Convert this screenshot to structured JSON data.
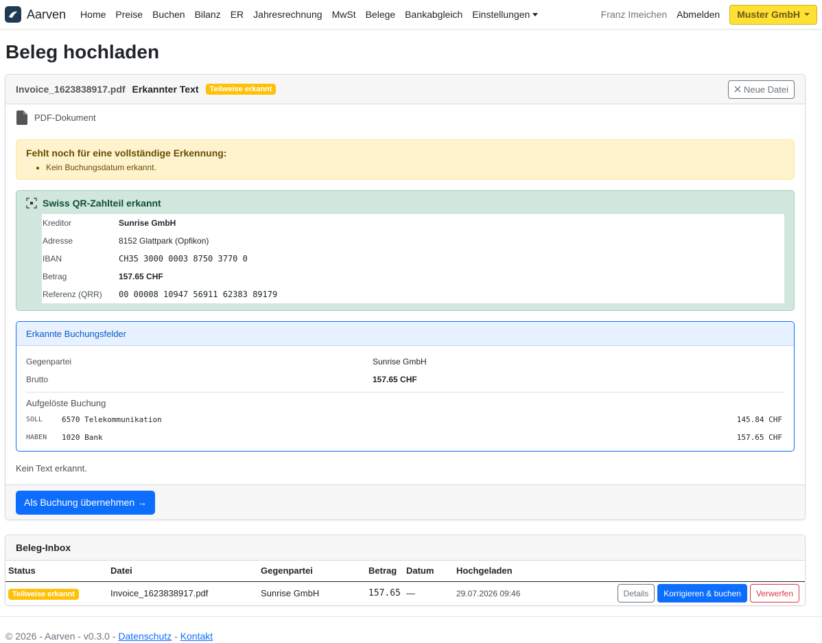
{
  "nav": {
    "brand": "Aarven",
    "items": [
      "Home",
      "Preise",
      "Buchen",
      "Bilanz",
      "ER",
      "Jahresrechnung",
      "MwSt",
      "Belege",
      "Bankabgleich"
    ],
    "settings": "Einstellungen",
    "user": "Franz Imeichen",
    "logout": "Abmelden",
    "org": "Muster GmbH"
  },
  "page_title": "Beleg hochladen",
  "upload": {
    "file_name": "Invoice_1623838917.pdf",
    "recognized_label": "Erkannter Text",
    "status_badge": "Teilweise erkannt",
    "new_file_button": "Neue Datei",
    "doc_type": "PDF-Dokument",
    "missing_title": "Fehlt noch für eine vollständige Erkennung:",
    "missing_items": [
      "Kein Buchungsdatum erkannt."
    ],
    "qr": {
      "title": "Swiss QR-Zahlteil erkannt",
      "rows": [
        {
          "label": "Kreditor",
          "value": "Sunrise GmbH"
        },
        {
          "label": "Adresse",
          "value": "8152 Glattpark (Opfikon)"
        },
        {
          "label": "IBAN",
          "value": "CH35 3000 0003 8750 3770 0"
        },
        {
          "label": "Betrag",
          "value": "157.65 CHF"
        },
        {
          "label": "Referenz (QRR)",
          "value": "00 00008 10947 56911 62383 89179"
        }
      ]
    },
    "fields": {
      "title": "Erkannte Buchungsfelder",
      "counterparty_label": "Gegenpartei",
      "counterparty_value": "Sunrise GmbH",
      "gross_label": "Brutto",
      "gross_value": "157.65 CHF",
      "resolved_title": "Aufgelöste Buchung",
      "entries": [
        {
          "side": "SOLL",
          "account": "6570 Telekommunikation",
          "amount": "145.84 CHF"
        },
        {
          "side": "HABEN",
          "account": "1020 Bank",
          "amount": "157.65 CHF"
        }
      ]
    },
    "no_text": "Kein Text erkannt.",
    "submit_button": "Als Buchung übernehmen →"
  },
  "inbox": {
    "title": "Beleg-Inbox",
    "columns": [
      "Status",
      "Datei",
      "Gegenpartei",
      "Betrag",
      "Datum",
      "Hochgeladen"
    ],
    "rows": [
      {
        "status": "Teilweise erkannt",
        "file": "Invoice_1623838917.pdf",
        "counterparty": "Sunrise GmbH",
        "amount": "157.65",
        "date": "—",
        "uploaded": "29.07.2026 09:46",
        "btn_details": "Details",
        "btn_correct": "Korrigieren & buchen",
        "btn_discard": "Verwerfen"
      }
    ]
  },
  "footer": {
    "text": "© 2026 - Aarven - v0.3.0 -",
    "sep": "-",
    "privacy": "Datenschutz",
    "contact": "Kontakt"
  },
  "colors": {
    "primary": "#0d6efd",
    "warning": "#ffc107",
    "org_button": "#ffe034",
    "success_bg": "#d1e7dd",
    "warning_bg": "#fff3cd"
  }
}
